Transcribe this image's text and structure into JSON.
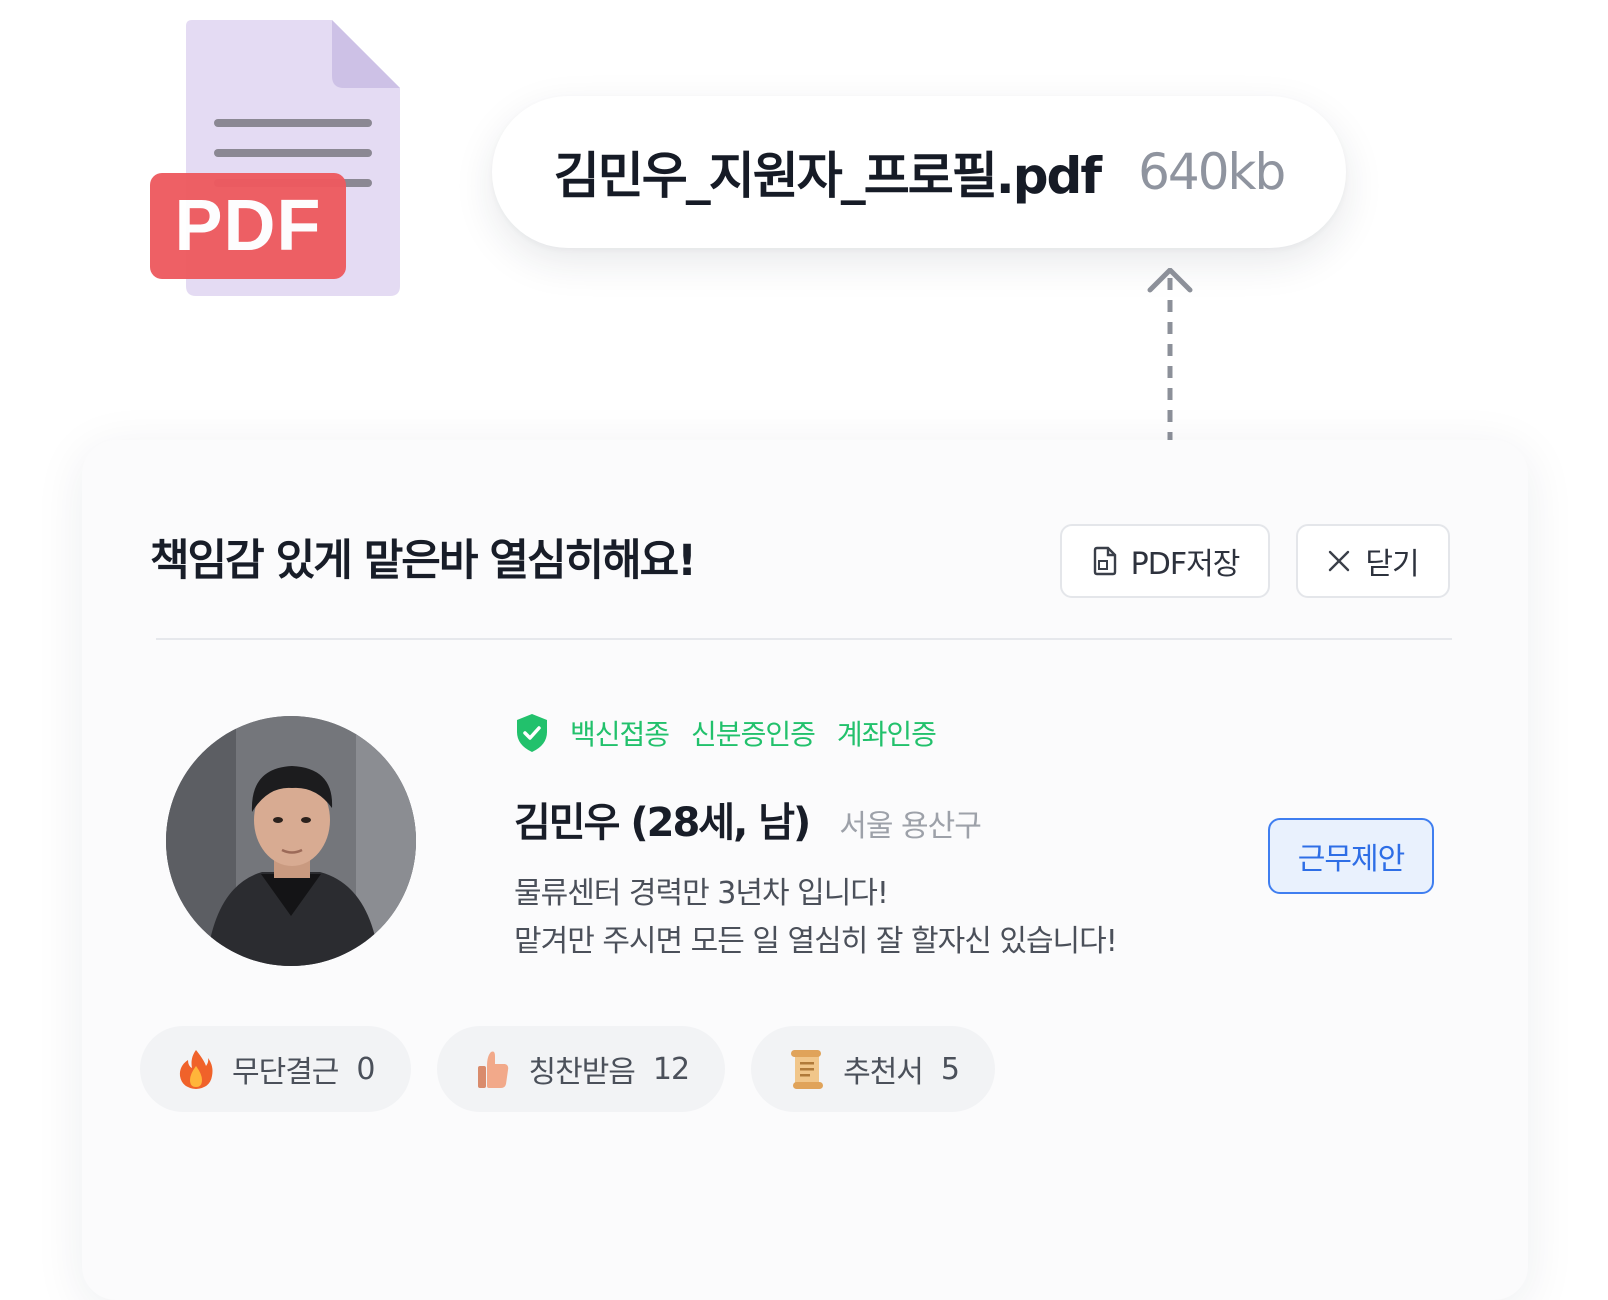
{
  "file": {
    "badge": "PDF",
    "name": "김민우_지원자_프로필.pdf",
    "size": "640kb"
  },
  "card": {
    "title": "책임감 있게 맡은바 열심히해요!",
    "pdf_button": "PDF저장",
    "close_button": "닫기",
    "verifications": [
      "백신접종",
      "신분증인증",
      "계좌인증"
    ],
    "name": "김민우 (28세, 남)",
    "location": "서울 용산구",
    "intro_line1": "물류센터 경력만 3년차 입니다!",
    "intro_line2": "맡겨만 주시면 모든 일 열심히 잘 할자신 있습니다!",
    "offer_button": "근무제안",
    "stats": [
      {
        "icon": "fire-icon",
        "label": "무단결근",
        "value": "0"
      },
      {
        "icon": "thumbs-up-icon",
        "label": "칭찬받음",
        "value": "12"
      },
      {
        "icon": "scroll-icon",
        "label": "추천서",
        "value": "5"
      }
    ]
  },
  "colors": {
    "accent_green": "#22c16c",
    "accent_blue": "#3f7ef0",
    "pdf_red": "#ee5a5f",
    "file_lavender": "#e4dbf3"
  }
}
